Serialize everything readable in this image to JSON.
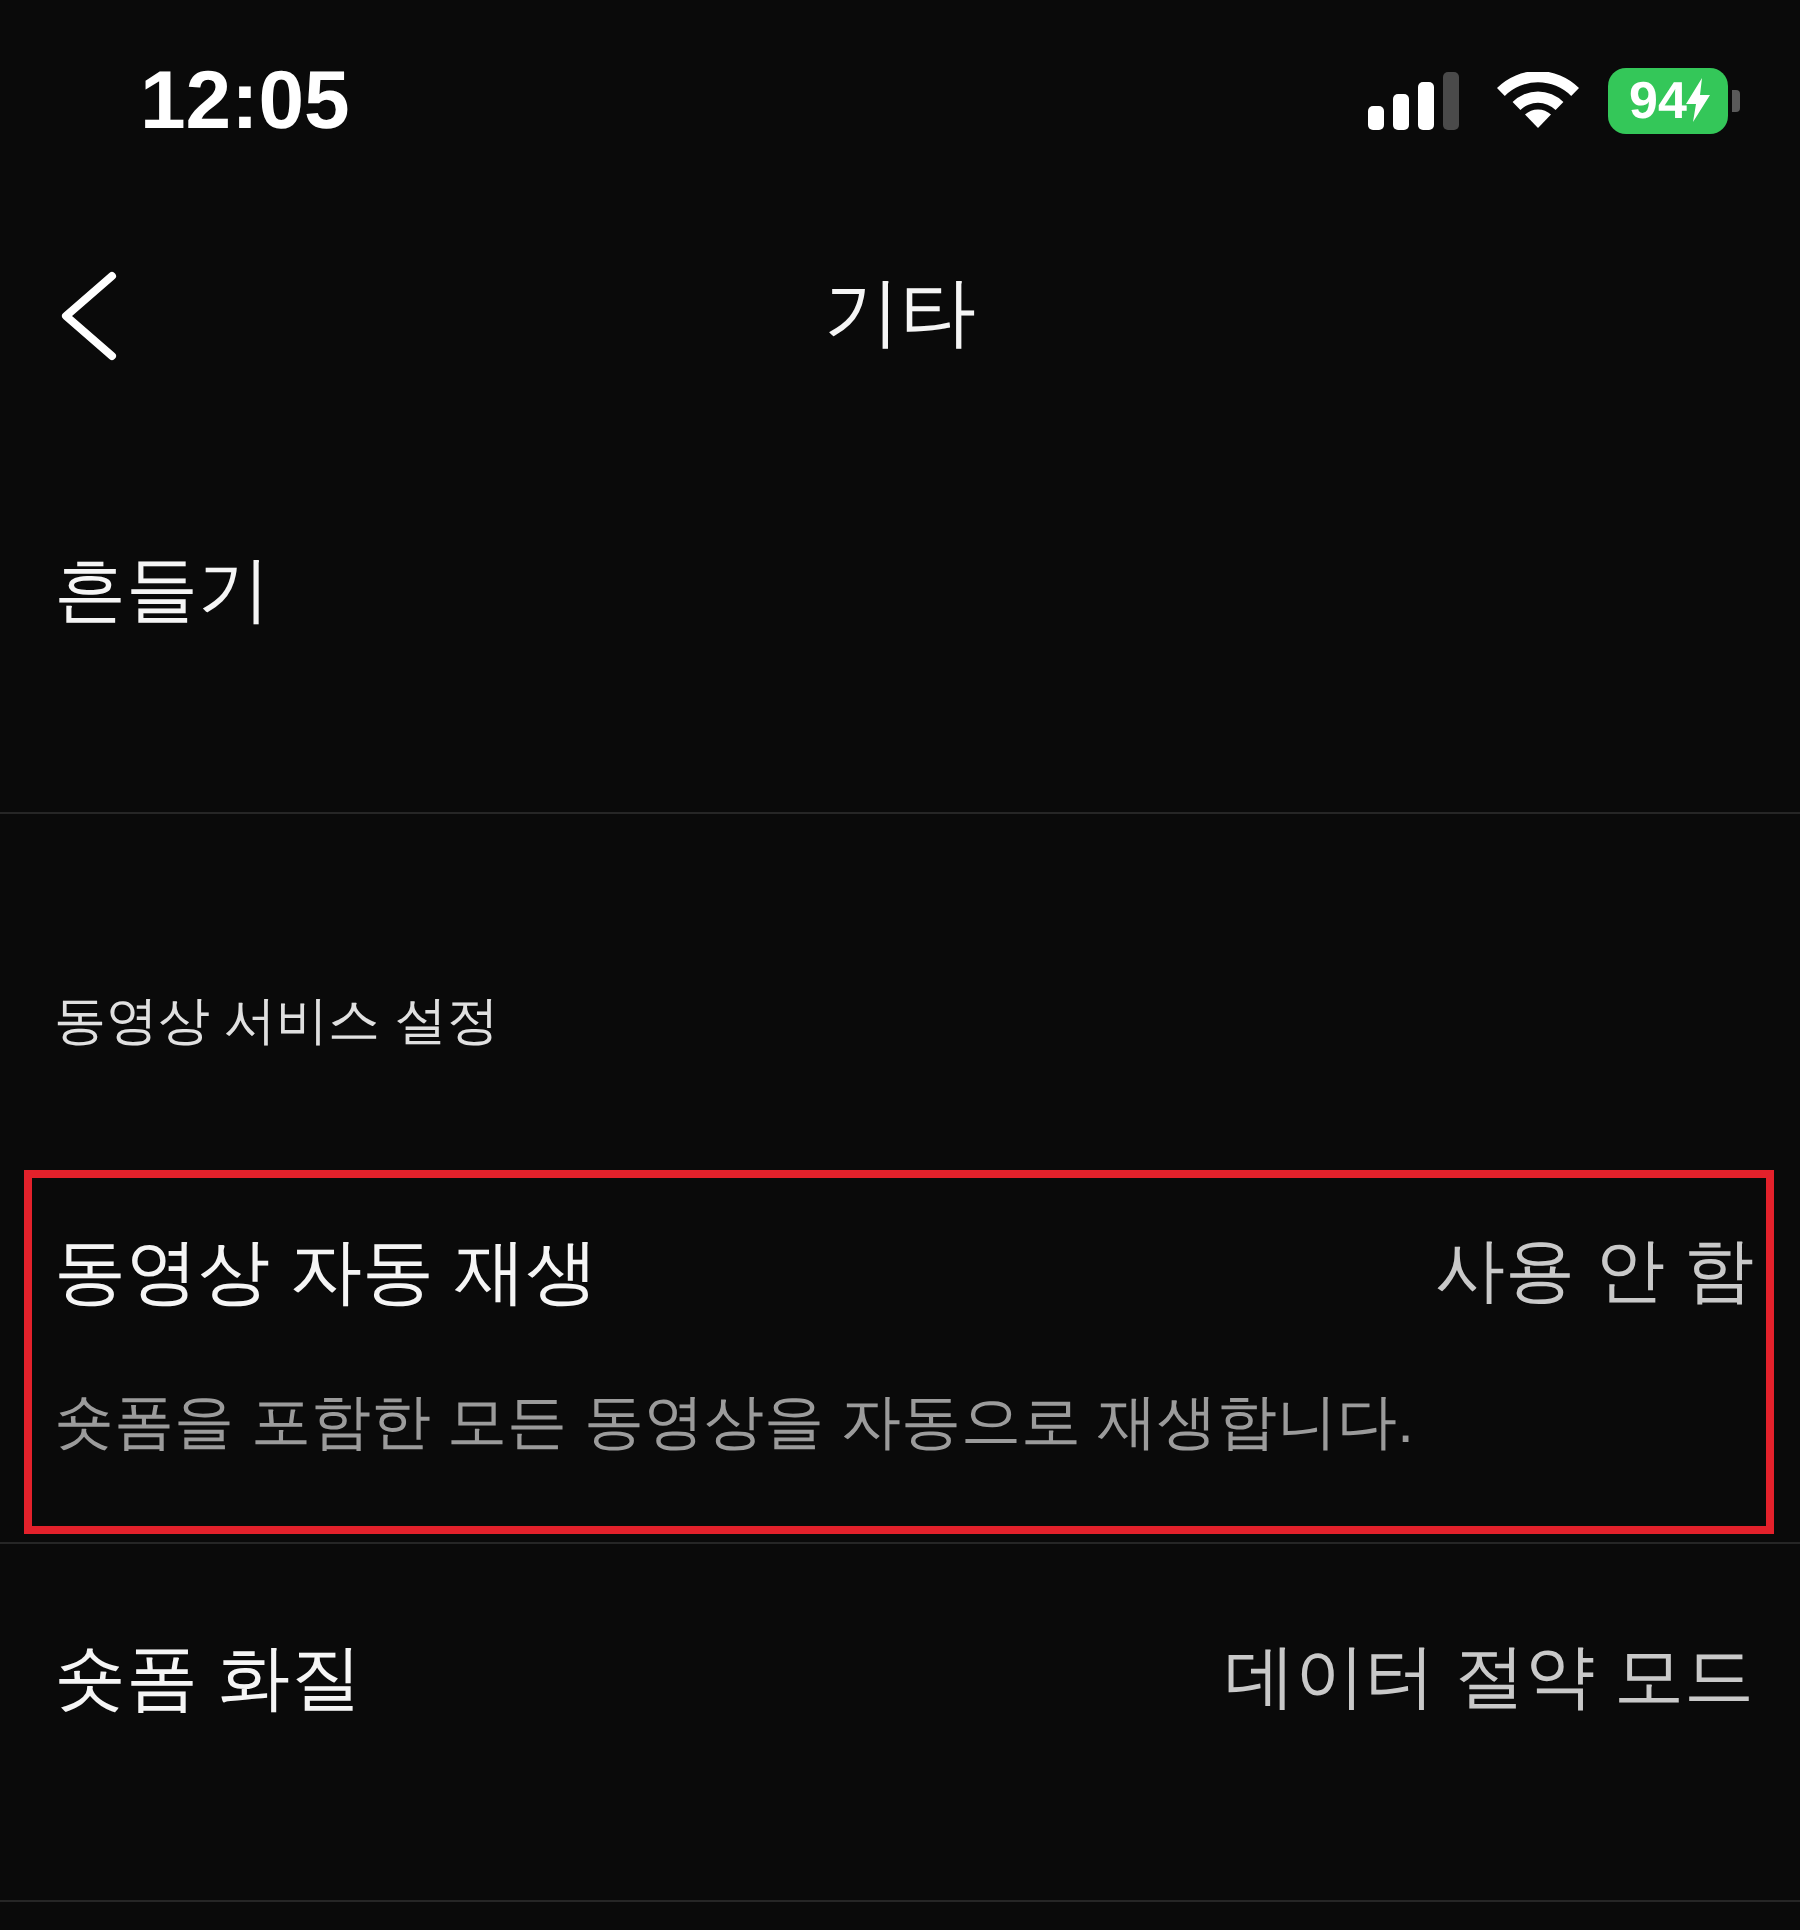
{
  "status_bar": {
    "time": "12:05",
    "battery": {
      "percent": "94",
      "charging": true
    }
  },
  "nav": {
    "title": "기타"
  },
  "sections": [
    {
      "items": [
        {
          "title": "흔들기",
          "highlighted": false
        }
      ]
    },
    {
      "header": "동영상 서비스 설정",
      "items": [
        {
          "title": "동영상 자동 재생",
          "value": "사용 안 함",
          "description": "숏폼을 포함한 모든 동영상을 자동으로 재생합니다.",
          "highlighted": true
        },
        {
          "title": "숏폼 화질",
          "value": "데이터 절약 모드",
          "highlighted": false
        }
      ]
    }
  ]
}
